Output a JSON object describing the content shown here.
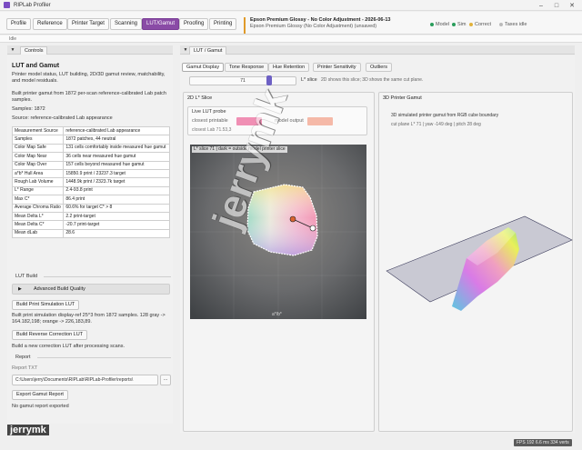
{
  "app": {
    "title": "RIPLab Profiler"
  },
  "nav": {
    "buttons": [
      "Profile",
      "Reference",
      "Printer Target",
      "Scanning",
      "LUT/Gamut",
      "Proofing",
      "Printing"
    ],
    "active": "LUT/Gamut"
  },
  "profile": {
    "line1": "Epson Premium Glossy - No Color Adjustment - 2026-06-13",
    "line2": "Epson Premium Glossy (No Color Adjustment) (unsaved)"
  },
  "status": {
    "model": "Model",
    "sim": "Sim",
    "correct": "Correct",
    "taxes": "Taxes idle",
    "colors": {
      "model": "#2a9d5c",
      "sim": "#2a9d5c",
      "correct": "#e2b23a",
      "taxes": "#bbbbbb"
    }
  },
  "idle_text": "Idle",
  "left_panel": {
    "header": "Controls",
    "title": "LUT and Gamut",
    "intro": "Printer model status, LUT building, 2D/3D gamut review, matchability, and model residuals.",
    "built_text": "Built printer gamut from 1872 per-scan reference-calibrated Lab patch samples.",
    "samples": "Samples: 1872",
    "source": "Source: reference-calibrated Lab appearance",
    "table": [
      {
        "k": "Measurement Source",
        "v": "reference-calibrated Lab appearance"
      },
      {
        "k": "Samples",
        "v": "1872 patches, 44 neutral"
      },
      {
        "k": "Color Map Safe",
        "v": "131 cells comfortably inside measured hue gamut"
      },
      {
        "k": "Color Map Near",
        "v": "36 cells near measured hue gamut"
      },
      {
        "k": "Color Map Over",
        "v": "157 cells beyond measured hue gamut"
      },
      {
        "k": "a*b* Hull Area",
        "v": "15850.9 print / 23237.3 target"
      },
      {
        "k": "Rough Lab Volume",
        "v": "1448.9k print / 2323.7k target"
      },
      {
        "k": "L* Range",
        "v": "2.4-93.8 print"
      },
      {
        "k": "Max C*",
        "v": "86.4 print"
      },
      {
        "k": "Average Chroma Ratio",
        "v": "60.6% for target C* > 8"
      },
      {
        "k": "Mean Delta L*",
        "v": "2.2 print-target"
      },
      {
        "k": "Mean Delta C*",
        "v": "-20.7 print-target"
      },
      {
        "k": "Mean dLab",
        "v": "28.6"
      }
    ],
    "lut_build": "LUT Build",
    "advanced": "Advanced Build Quality",
    "build_sim": "Build Print Simulation LUT",
    "build_sim_text": "Built print simulation display-ref 25^3 from 1872 samples. 128 gray -> 164.182,198; orange -> 226,183,89.",
    "build_rev": "Build Reverse Correction LUT",
    "build_rev_text": "Build a new correction LUT after processing scans.",
    "report": "Report",
    "report_txt": "Report TXT",
    "report_path": "C:\\Users\\jerry\\Documents\\RIPLab\\RIPLab-Profiler\\reports\\",
    "browse": "...",
    "export": "Export Gamut Report",
    "no_report": "No gamut report exported"
  },
  "right_panel": {
    "header": "LUT / Gamut",
    "tabs": [
      "Gamut Display",
      "Tone Response",
      "Hue Retention",
      "Printer Sensitivity",
      "Outliers"
    ],
    "active_tab": "Gamut Display",
    "slice_value": "71",
    "slice_label": "L* slice",
    "slice_note": "2D shows this slice; 3D shows the same cut plane.",
    "slice_fraction": 0.76,
    "card2d": {
      "title": "2D L* Slice",
      "probe_title": "Live LUT probe",
      "closest_printable": "closest printable",
      "model_output": "model output",
      "closest_lab": "closest Lab 71.53,3",
      "closest_color": "#f08fb4",
      "model_color": "#f5b9a8",
      "plot_label": "L* slice 71 | dark = outside model printer slice",
      "axis_label": "a*/b*"
    },
    "card3d": {
      "title": "3D Printer Gamut",
      "desc": "3D simulated printer gamut from RGB cube boundary",
      "cut": "cut plane L* 71 | yaw -149 deg | pitch 28 deg"
    }
  },
  "footer": {
    "fps": "FPS 192 6.6 ms 334 verts"
  },
  "watermark": {
    "text1": "jerrymk",
    "text2": "jerrymk"
  }
}
